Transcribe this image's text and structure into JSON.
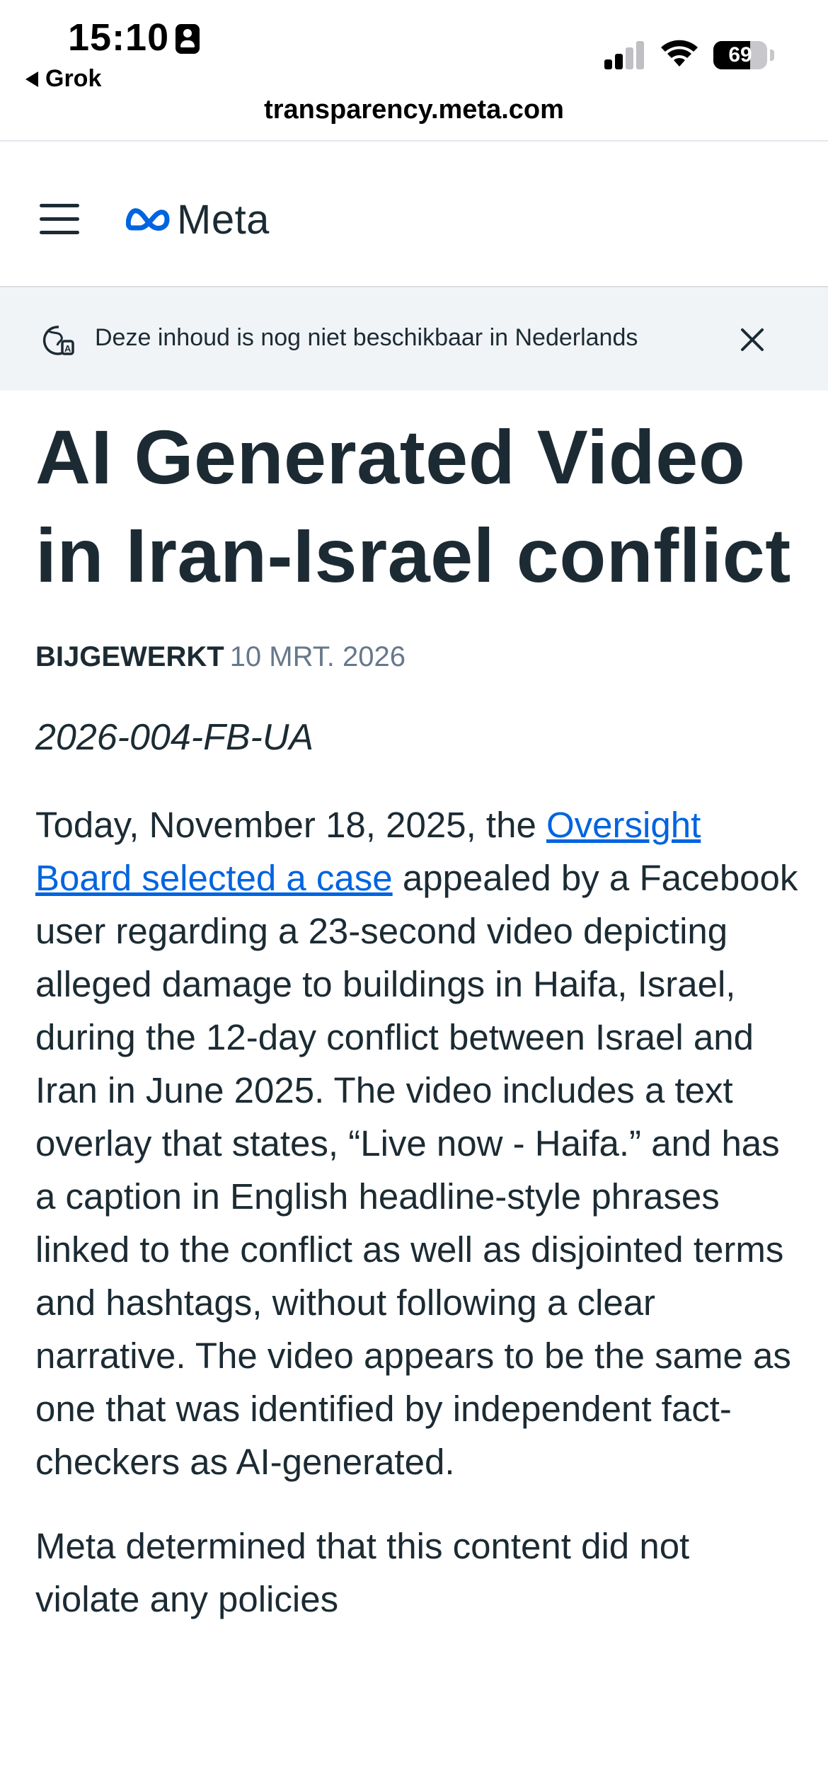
{
  "status_bar": {
    "time": "15:10",
    "back_app": "Grok",
    "battery": "69",
    "battery_level": 0.69
  },
  "browser": {
    "url": "transparency.meta.com"
  },
  "header": {
    "logo_text": "Meta",
    "logo_color": "#0064e0"
  },
  "banner": {
    "message": "Deze inhoud is nog niet beschikbaar in Nederlands"
  },
  "article": {
    "title": "AI Generated Video in Iran-Israel conflict",
    "updated_label": "BIJGEWERKT",
    "updated_date": "10 MRT. 2026",
    "case_id": "2026-004-FB-UA",
    "paragraph1_before_link": "Today, November 18, 2025, the ",
    "paragraph1_link": "Oversight Board selected a case",
    "paragraph1_after_link": " appealed by a Facebook user regarding a 23-second video depicting alleged damage to buildings in Haifa, Israel, during the 12-day conflict between Israel and Iran in June 2025. The video includes a text overlay that states, “Live now - Haifa.” and has a caption in English headline-style phrases linked to the conflict as well as disjointed terms and hashtags, without following a clear narrative. The video appears to be the same as one that was identified by independent fact-checkers as AI-generated.",
    "paragraph2": "Meta determined that this content did not violate any policies"
  }
}
